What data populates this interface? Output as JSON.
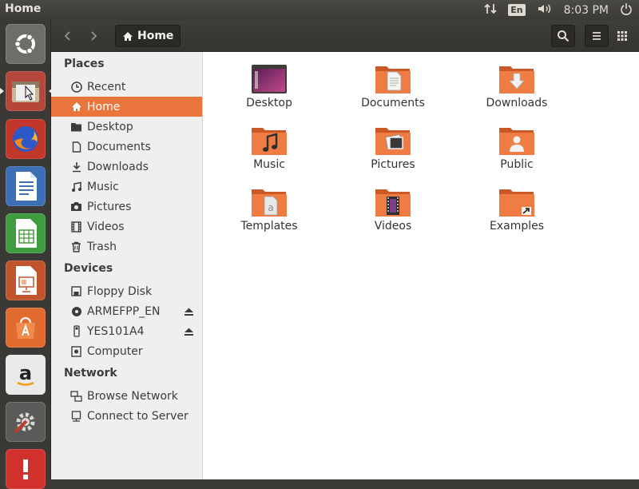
{
  "panel": {
    "title": "Home",
    "lang": "En",
    "clock": "8:03 PM"
  },
  "launcher": {
    "items": [
      "ubuntu-dash",
      "files",
      "firefox",
      "libreoffice-writer",
      "libreoffice-calc",
      "libreoffice-impress",
      "ubuntu-software",
      "amazon",
      "system-settings",
      "software-updater"
    ]
  },
  "header": {
    "breadcrumb": "Home"
  },
  "sidebar": {
    "places_heading": "Places",
    "places": [
      {
        "label": "Recent",
        "icon": "clock-icon"
      },
      {
        "label": "Home",
        "icon": "home-icon"
      },
      {
        "label": "Desktop",
        "icon": "folder-icon"
      },
      {
        "label": "Documents",
        "icon": "document-icon"
      },
      {
        "label": "Downloads",
        "icon": "download-icon"
      },
      {
        "label": "Music",
        "icon": "music-icon"
      },
      {
        "label": "Pictures",
        "icon": "camera-icon"
      },
      {
        "label": "Videos",
        "icon": "film-icon"
      },
      {
        "label": "Trash",
        "icon": "trash-icon"
      }
    ],
    "devices_heading": "Devices",
    "devices": [
      {
        "label": "Floppy Disk",
        "icon": "floppy-icon"
      },
      {
        "label": "ARMEFPP_EN",
        "icon": "disc-icon"
      },
      {
        "label": "YES101A4",
        "icon": "usb-icon"
      },
      {
        "label": "Computer",
        "icon": "computer-icon"
      }
    ],
    "network_heading": "Network",
    "network": [
      {
        "label": "Browse Network",
        "icon": "network-icon"
      },
      {
        "label": "Connect to Server",
        "icon": "server-icon"
      }
    ]
  },
  "folders": [
    {
      "label": "Desktop"
    },
    {
      "label": "Documents"
    },
    {
      "label": "Downloads"
    },
    {
      "label": "Music"
    },
    {
      "label": "Pictures"
    },
    {
      "label": "Public"
    },
    {
      "label": "Templates"
    },
    {
      "label": "Videos"
    },
    {
      "label": "Examples"
    }
  ],
  "colors": {
    "accent": "#e9743c",
    "panel": "#3c3b37"
  }
}
